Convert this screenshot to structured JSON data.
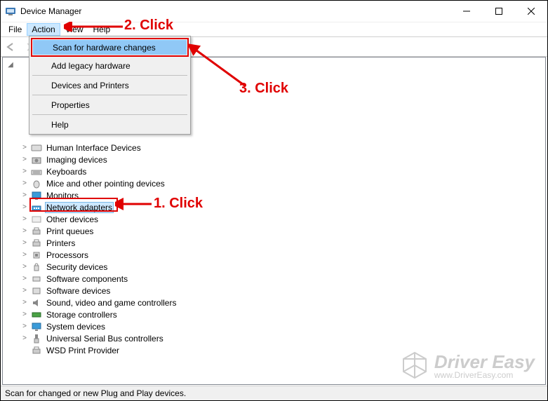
{
  "window": {
    "title": "Device Manager"
  },
  "menubar": {
    "file": "File",
    "action": "Action",
    "view": "View",
    "help": "Help"
  },
  "dropdown": {
    "scan": "Scan for hardware changes",
    "legacy": "Add legacy hardware",
    "devp": "Devices and Printers",
    "prop": "Properties",
    "help": "Help"
  },
  "tree": {
    "hid": "Human Interface Devices",
    "img": "Imaging devices",
    "kbd": "Keyboards",
    "mouse": "Mice and other pointing devices",
    "mon": "Monitors",
    "net": "Network adapters",
    "other": "Other devices",
    "printq": "Print queues",
    "printers": "Printers",
    "proc": "Processors",
    "sec": "Security devices",
    "swc": "Software components",
    "swd": "Software devices",
    "sound": "Sound, video and game controllers",
    "stor": "Storage controllers",
    "sys": "System devices",
    "usb": "Universal Serial Bus controllers",
    "wsd": "WSD Print Provider"
  },
  "statusbar": "Scan for changed or new Plug and Play devices.",
  "annotations": {
    "a1": "1. Click",
    "a2": "2. Click",
    "a3": "3. Click"
  },
  "watermark": {
    "brand": "Driver Easy",
    "url": "www.DriverEasy.com"
  }
}
